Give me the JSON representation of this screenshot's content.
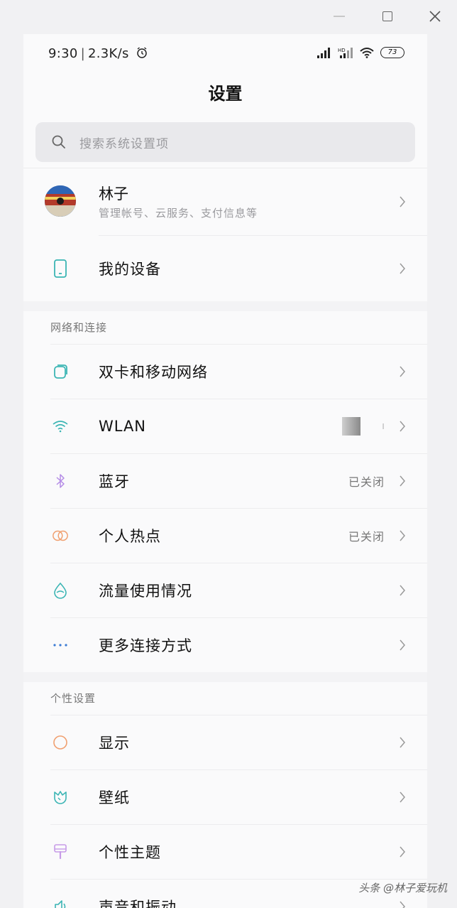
{
  "status": {
    "time": "9:30",
    "speed": "2.3K/s",
    "battery": "73"
  },
  "header": {
    "title": "设置"
  },
  "search": {
    "placeholder": "搜索系统设置项"
  },
  "account": {
    "name": "林子",
    "subtitle": "管理帐号、云服务、支付信息等"
  },
  "device": {
    "label": "我的设备"
  },
  "network": {
    "section_title": "网络和连接",
    "items": [
      {
        "label": "双卡和移动网络",
        "value": ""
      },
      {
        "label": "WLAN",
        "value": ""
      },
      {
        "label": "蓝牙",
        "value": "已关闭"
      },
      {
        "label": "个人热点",
        "value": "已关闭"
      },
      {
        "label": "流量使用情况",
        "value": ""
      },
      {
        "label": "更多连接方式",
        "value": ""
      }
    ]
  },
  "personal": {
    "section_title": "个性设置",
    "items": [
      {
        "label": "显示"
      },
      {
        "label": "壁纸"
      },
      {
        "label": "个性主题"
      },
      {
        "label": "声音和振动"
      }
    ]
  },
  "watermark": "头条 @林子爱玩机",
  "colors": {
    "teal": "#3bb5b4",
    "purple": "#b48be6",
    "orange": "#f0a070",
    "lavender": "#c79be8",
    "text": "#111111",
    "muted": "#9a9a9e"
  }
}
